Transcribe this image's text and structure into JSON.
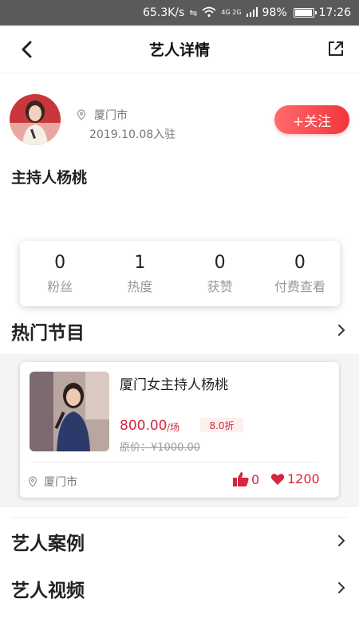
{
  "status_bar": {
    "net_speed": "65.3K/s",
    "network": "4G 2G",
    "battery": "98%",
    "time": "17:26",
    "battery_level": 0.98
  },
  "header": {
    "title": "艺人详情",
    "back_icon": "chevron-left-icon",
    "share_icon": "share-external-icon"
  },
  "profile": {
    "location": "厦门市",
    "join_date": "2019.10.08入驻",
    "follow_label": "+关注",
    "name": "主持人杨桃"
  },
  "stats": [
    {
      "value": "0",
      "label": "粉丝"
    },
    {
      "value": "1",
      "label": "热度"
    },
    {
      "value": "0",
      "label": "获赞"
    },
    {
      "value": "0",
      "label": "付费查看"
    }
  ],
  "sections": {
    "hot_programs": "热门节目",
    "cases": "艺人案例",
    "videos": "艺人视频"
  },
  "program": {
    "title": "厦门女主持人杨桃",
    "price": "800.00",
    "unit": "/场",
    "discount": "8.0折",
    "original_price": "原价：¥1000.00",
    "location": "厦门市",
    "likes": "0",
    "hearts": "1200"
  },
  "colors": {
    "accent": "#f0353d",
    "price": "#d7263d",
    "status_bar": "#5a5a5a"
  }
}
